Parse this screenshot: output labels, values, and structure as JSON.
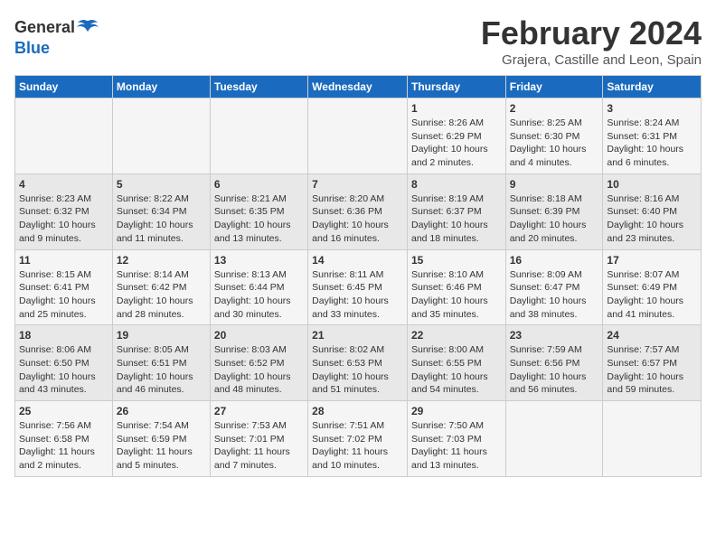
{
  "header": {
    "logo_general": "General",
    "logo_blue": "Blue",
    "month_title": "February 2024",
    "location": "Grajera, Castille and Leon, Spain"
  },
  "days_of_week": [
    "Sunday",
    "Monday",
    "Tuesday",
    "Wednesday",
    "Thursday",
    "Friday",
    "Saturday"
  ],
  "weeks": [
    [
      {
        "day": "",
        "info": ""
      },
      {
        "day": "",
        "info": ""
      },
      {
        "day": "",
        "info": ""
      },
      {
        "day": "",
        "info": ""
      },
      {
        "day": "1",
        "info": "Sunrise: 8:26 AM\nSunset: 6:29 PM\nDaylight: 10 hours and 2 minutes."
      },
      {
        "day": "2",
        "info": "Sunrise: 8:25 AM\nSunset: 6:30 PM\nDaylight: 10 hours and 4 minutes."
      },
      {
        "day": "3",
        "info": "Sunrise: 8:24 AM\nSunset: 6:31 PM\nDaylight: 10 hours and 6 minutes."
      }
    ],
    [
      {
        "day": "4",
        "info": "Sunrise: 8:23 AM\nSunset: 6:32 PM\nDaylight: 10 hours and 9 minutes."
      },
      {
        "day": "5",
        "info": "Sunrise: 8:22 AM\nSunset: 6:34 PM\nDaylight: 10 hours and 11 minutes."
      },
      {
        "day": "6",
        "info": "Sunrise: 8:21 AM\nSunset: 6:35 PM\nDaylight: 10 hours and 13 minutes."
      },
      {
        "day": "7",
        "info": "Sunrise: 8:20 AM\nSunset: 6:36 PM\nDaylight: 10 hours and 16 minutes."
      },
      {
        "day": "8",
        "info": "Sunrise: 8:19 AM\nSunset: 6:37 PM\nDaylight: 10 hours and 18 minutes."
      },
      {
        "day": "9",
        "info": "Sunrise: 8:18 AM\nSunset: 6:39 PM\nDaylight: 10 hours and 20 minutes."
      },
      {
        "day": "10",
        "info": "Sunrise: 8:16 AM\nSunset: 6:40 PM\nDaylight: 10 hours and 23 minutes."
      }
    ],
    [
      {
        "day": "11",
        "info": "Sunrise: 8:15 AM\nSunset: 6:41 PM\nDaylight: 10 hours and 25 minutes."
      },
      {
        "day": "12",
        "info": "Sunrise: 8:14 AM\nSunset: 6:42 PM\nDaylight: 10 hours and 28 minutes."
      },
      {
        "day": "13",
        "info": "Sunrise: 8:13 AM\nSunset: 6:44 PM\nDaylight: 10 hours and 30 minutes."
      },
      {
        "day": "14",
        "info": "Sunrise: 8:11 AM\nSunset: 6:45 PM\nDaylight: 10 hours and 33 minutes."
      },
      {
        "day": "15",
        "info": "Sunrise: 8:10 AM\nSunset: 6:46 PM\nDaylight: 10 hours and 35 minutes."
      },
      {
        "day": "16",
        "info": "Sunrise: 8:09 AM\nSunset: 6:47 PM\nDaylight: 10 hours and 38 minutes."
      },
      {
        "day": "17",
        "info": "Sunrise: 8:07 AM\nSunset: 6:49 PM\nDaylight: 10 hours and 41 minutes."
      }
    ],
    [
      {
        "day": "18",
        "info": "Sunrise: 8:06 AM\nSunset: 6:50 PM\nDaylight: 10 hours and 43 minutes."
      },
      {
        "day": "19",
        "info": "Sunrise: 8:05 AM\nSunset: 6:51 PM\nDaylight: 10 hours and 46 minutes."
      },
      {
        "day": "20",
        "info": "Sunrise: 8:03 AM\nSunset: 6:52 PM\nDaylight: 10 hours and 48 minutes."
      },
      {
        "day": "21",
        "info": "Sunrise: 8:02 AM\nSunset: 6:53 PM\nDaylight: 10 hours and 51 minutes."
      },
      {
        "day": "22",
        "info": "Sunrise: 8:00 AM\nSunset: 6:55 PM\nDaylight: 10 hours and 54 minutes."
      },
      {
        "day": "23",
        "info": "Sunrise: 7:59 AM\nSunset: 6:56 PM\nDaylight: 10 hours and 56 minutes."
      },
      {
        "day": "24",
        "info": "Sunrise: 7:57 AM\nSunset: 6:57 PM\nDaylight: 10 hours and 59 minutes."
      }
    ],
    [
      {
        "day": "25",
        "info": "Sunrise: 7:56 AM\nSunset: 6:58 PM\nDaylight: 11 hours and 2 minutes."
      },
      {
        "day": "26",
        "info": "Sunrise: 7:54 AM\nSunset: 6:59 PM\nDaylight: 11 hours and 5 minutes."
      },
      {
        "day": "27",
        "info": "Sunrise: 7:53 AM\nSunset: 7:01 PM\nDaylight: 11 hours and 7 minutes."
      },
      {
        "day": "28",
        "info": "Sunrise: 7:51 AM\nSunset: 7:02 PM\nDaylight: 11 hours and 10 minutes."
      },
      {
        "day": "29",
        "info": "Sunrise: 7:50 AM\nSunset: 7:03 PM\nDaylight: 11 hours and 13 minutes."
      },
      {
        "day": "",
        "info": ""
      },
      {
        "day": "",
        "info": ""
      }
    ]
  ]
}
